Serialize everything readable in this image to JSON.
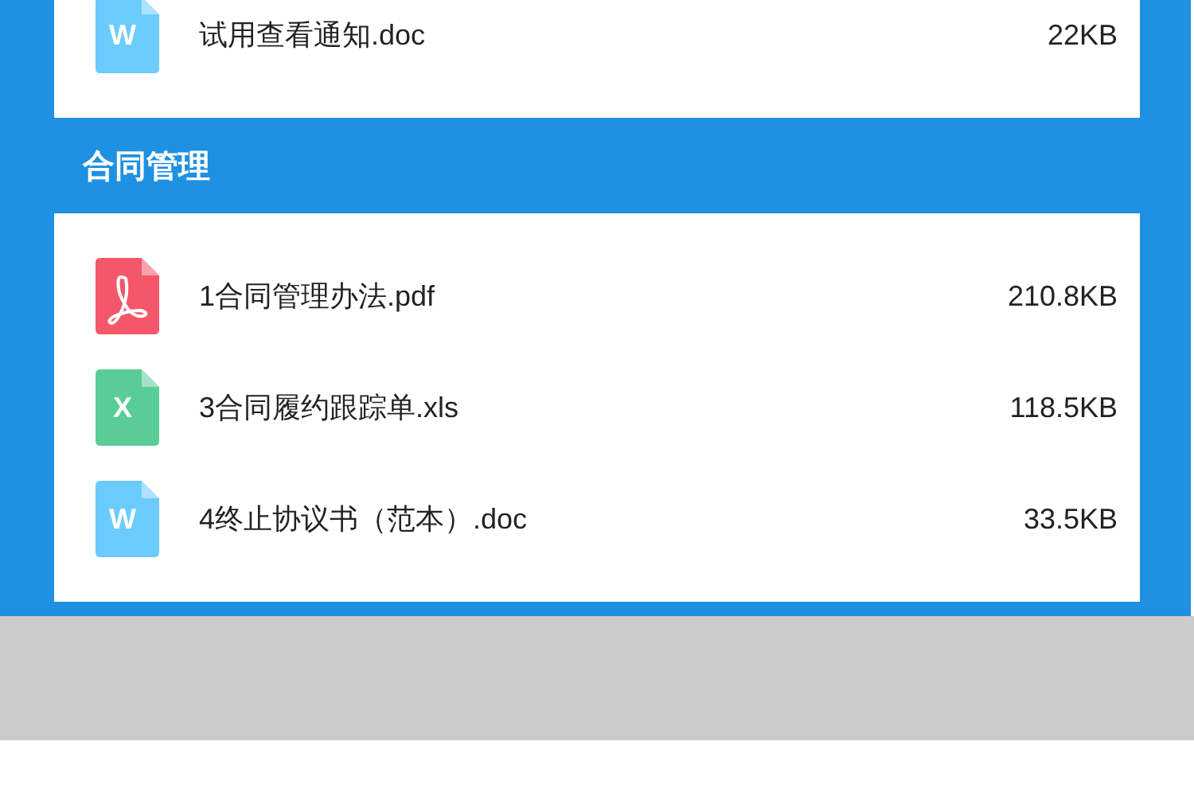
{
  "sections": [
    {
      "files": [
        {
          "kind": "doc",
          "badge": "W",
          "name": "试用查看通知.doc",
          "size": "22KB"
        }
      ]
    },
    {
      "title": "合同管理",
      "files": [
        {
          "kind": "pdf",
          "name": "1合同管理办法.pdf",
          "size": "210.8KB"
        },
        {
          "kind": "xls",
          "badge": "X",
          "name": "3合同履约跟踪单.xls",
          "size": "118.5KB"
        },
        {
          "kind": "doc",
          "badge": "W",
          "name": "4终止协议书（范本）.doc",
          "size": "33.5KB"
        }
      ]
    }
  ]
}
